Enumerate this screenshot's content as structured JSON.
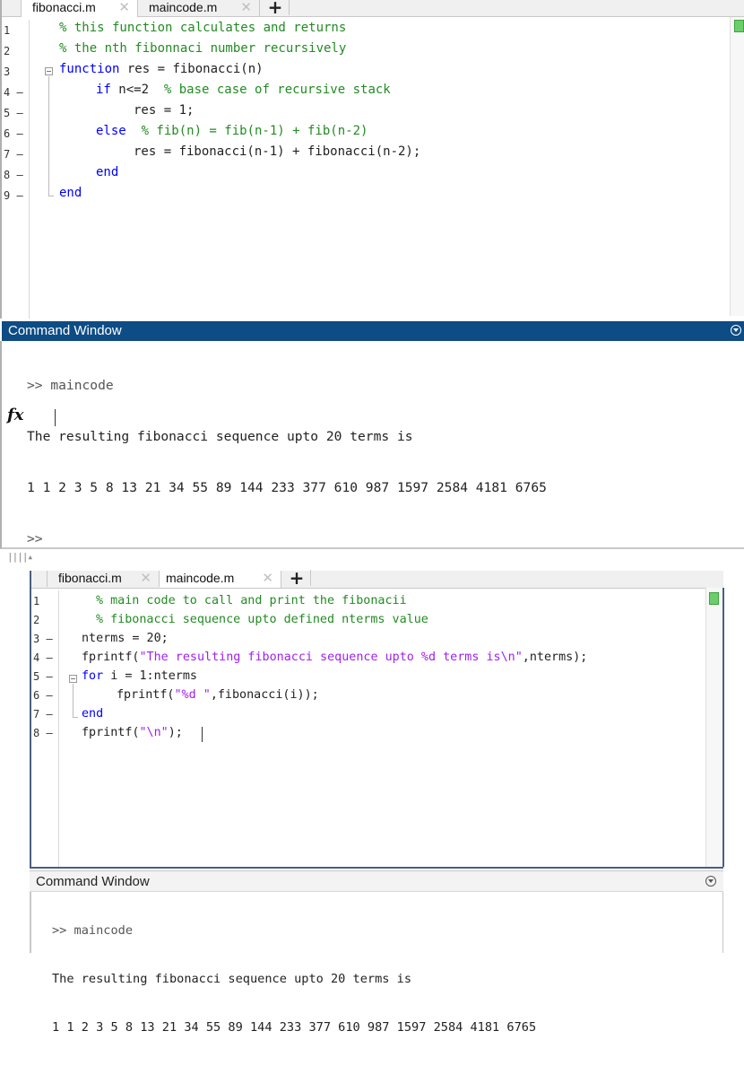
{
  "top": {
    "tabs": [
      {
        "label": "fibonacci.m",
        "close": "✕"
      },
      {
        "label": "maincode.m",
        "close": "✕"
      }
    ],
    "add_tab": "+",
    "line_numbers": [
      "1",
      "2",
      "3",
      "4 —",
      "5 —",
      "6 —",
      "7 —",
      "8 —",
      "9 —"
    ],
    "code": [
      "% this function calculates and returns",
      "% the nth fibonnaci number recursively",
      "function res = fibonacci(n)",
      "if n<=2  % base case of recursive stack",
      "res = 1;",
      "else  % fib(n) = fib(n-1) + fib(n-2)",
      "res = fibonacci(n-1) + fibonacci(n-2);",
      "end",
      "end"
    ],
    "command_window": {
      "title": "Command Window",
      "lines": [
        ">> maincode",
        "The resulting fibonacci sequence upto 20 terms is",
        "1 1 2 3 5 8 13 21 34 55 89 144 233 377 610 987 1597 2584 4181 6765"
      ],
      "fx_label": "fx",
      "prompt": ">>"
    }
  },
  "bottom": {
    "tabs": [
      {
        "label": "fibonacci.m",
        "close": "✕"
      },
      {
        "label": "maincode.m",
        "close": "✕"
      }
    ],
    "add_tab": "+",
    "line_numbers": [
      "1",
      "2",
      "3 —",
      "4 —",
      "5 —",
      "6 —",
      "7 —",
      "8 —"
    ],
    "code": [
      "% main code to call and print the fibonacii",
      "% fibonacci sequence upto defined nterms value",
      "nterms = 20;",
      "fprintf(\"The resulting fibonacci sequence upto %d terms is\\n\",nterms);",
      "for i = 1:nterms",
      "fprintf(\"%d \",fibonacci(i));",
      "end",
      "fprintf(\"\\n\");"
    ],
    "command_window": {
      "title": "Command Window",
      "lines": [
        ">> maincode",
        "The resulting fibonacci sequence upto 20 terms is",
        "1 1 2 3 5 8 13 21 34 55 89 144 233 377 610 987 1597 2584 4181 6765"
      ]
    }
  },
  "colors": {
    "comment": "#228b22",
    "keyword": "#0000ff",
    "string": "#a020f0",
    "command_header_active": "#0d4c84"
  }
}
